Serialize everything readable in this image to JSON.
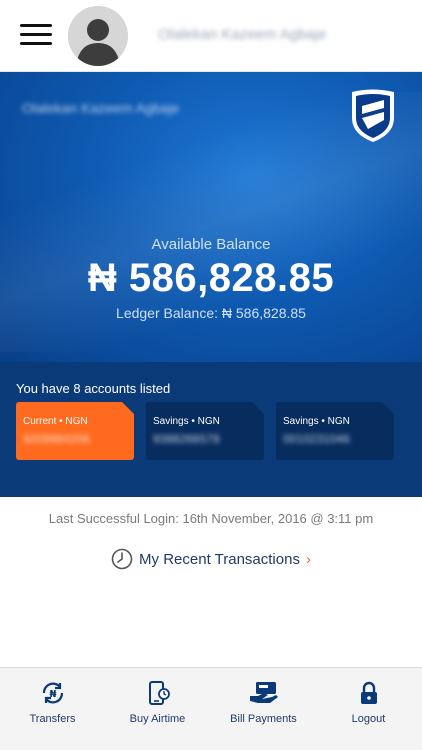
{
  "header": {
    "user_name": "Olalekan Kazeem Agbaje"
  },
  "hero": {
    "account_holder": "Olalekan Kazeem Agbaje",
    "available_label": "Available Balance",
    "balance": "₦ 586,828.85",
    "ledger": "Ledger Balance: ₦ 586,828.85"
  },
  "accounts": {
    "title": "You have 8 accounts listed",
    "items": [
      {
        "type": "Current • NGN",
        "number": "9209984206",
        "selected": true
      },
      {
        "type": "Savings • NGN",
        "number": "9388266578",
        "selected": false
      },
      {
        "type": "Savings • NGN",
        "number": "0010231046",
        "selected": false
      }
    ]
  },
  "last_login": "Last Successful Login: 16th November, 2016 @ 3:11 pm",
  "recent": {
    "label": "My Recent Transactions",
    "arrow": "›"
  },
  "nav": [
    {
      "label": "Transfers",
      "icon": "transfer-icon"
    },
    {
      "label": "Buy Airtime",
      "icon": "phone-topup-icon"
    },
    {
      "label": "Bill Payments",
      "icon": "card-payment-icon"
    },
    {
      "label": "Logout",
      "icon": "lock-icon"
    }
  ],
  "colors": {
    "brand_blue": "#0f5bb3",
    "navy": "#0b3a78",
    "accent_orange": "#ff6a1f",
    "nav_text": "#1f3b6b"
  }
}
